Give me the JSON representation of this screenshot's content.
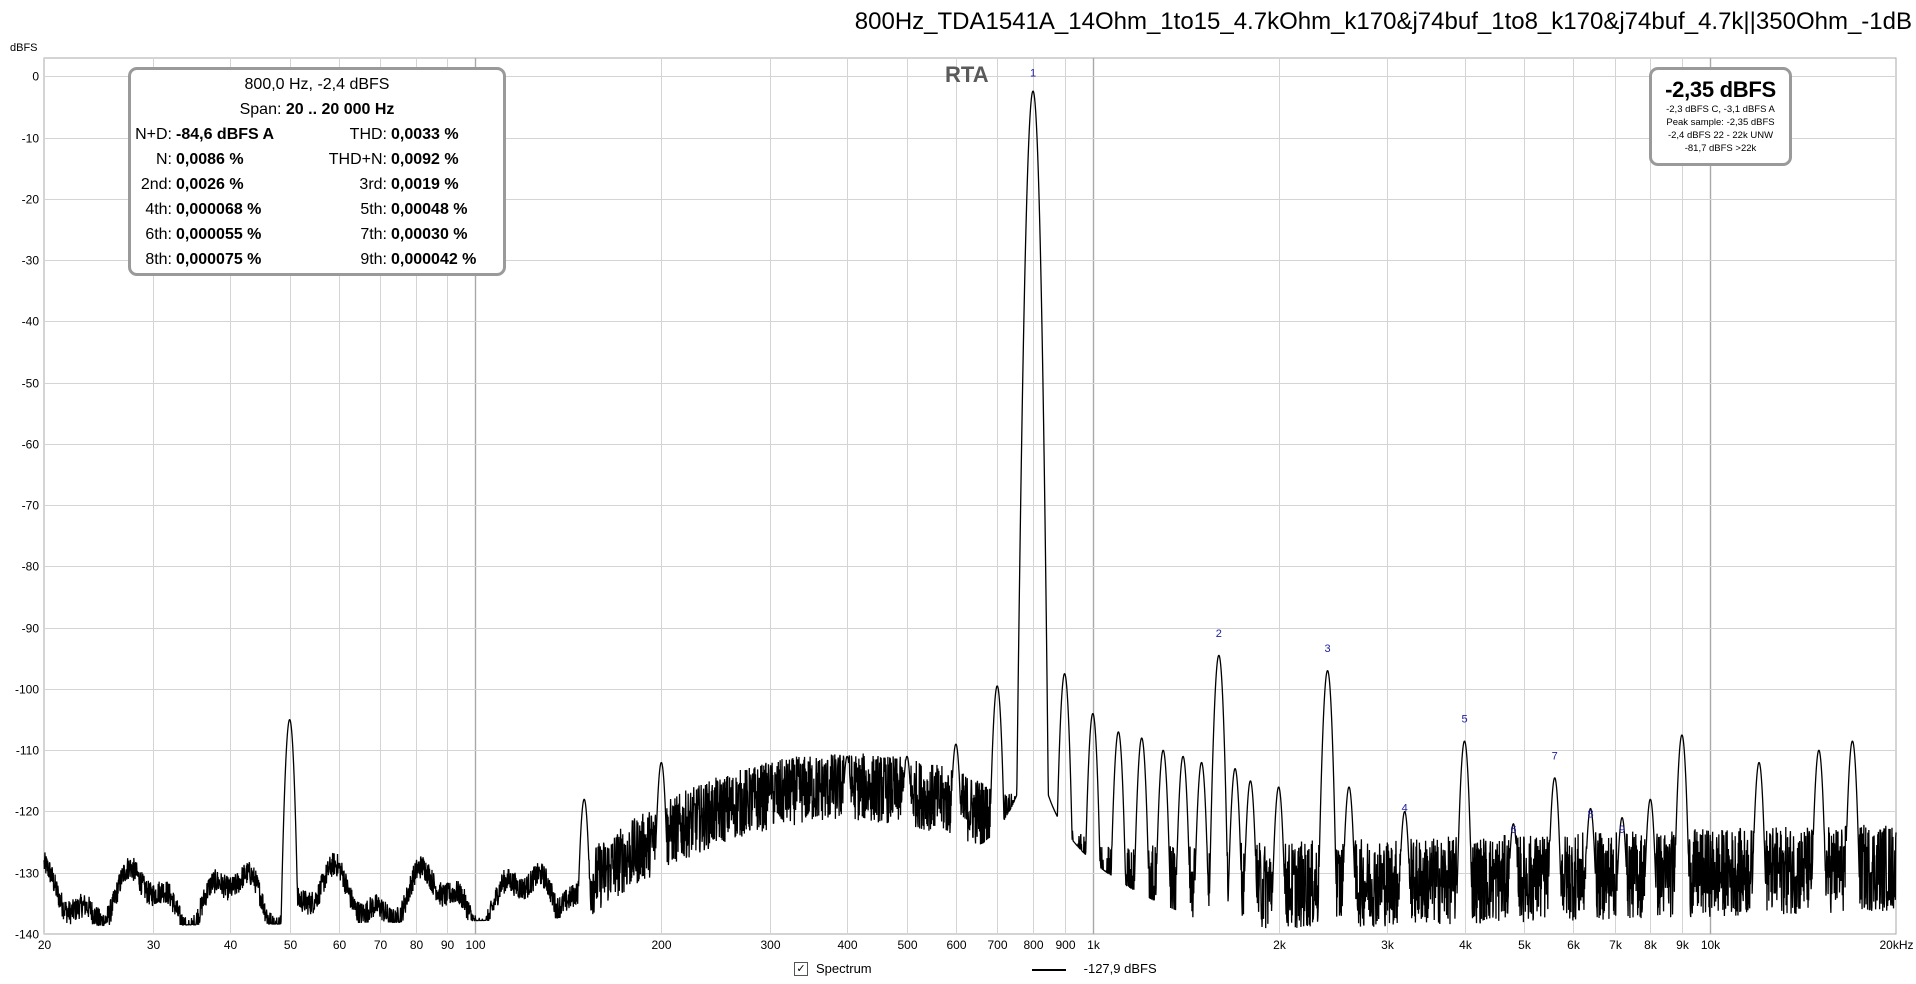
{
  "title": "800Hz_TDA1541A_14Ohm_1to15_4.7kOhm_k170&j74buf_1to8_k170&j74buf_4.7k||350Ohm_-1dB",
  "panel_label": "RTA",
  "y_unit": "dBFS",
  "stats": {
    "header": "800,0 Hz, -2,4 dBFS",
    "span_label": "Span:",
    "span_value": "20 .. 20 000 Hz",
    "rows": [
      {
        "l1": "N+D:",
        "v1": "-84,6 dBFS A",
        "l2": "THD:",
        "v2": "0,0033 %"
      },
      {
        "l1": "N:",
        "v1": "0,0086 %",
        "l2": "THD+N:",
        "v2": "0,0092 %"
      },
      {
        "l1": "2nd:",
        "v1": "0,0026 %",
        "l2": "3rd:",
        "v2": "0,0019 %"
      },
      {
        "l1": "4th:",
        "v1": "0,000068 %",
        "l2": "5th:",
        "v2": "0,00048 %"
      },
      {
        "l1": "6th:",
        "v1": "0,000055 %",
        "l2": "7th:",
        "v2": "0,00030 %"
      },
      {
        "l1": "8th:",
        "v1": "0,000075 %",
        "l2": "9th:",
        "v2": "0,000042 %"
      }
    ]
  },
  "level": {
    "main": "-2,35 dBFS",
    "line1": "-2,3 dBFS C, -3,1 dBFS A",
    "line2": "Peak sample: -2,35 dBFS",
    "line3": "-2,4 dBFS 22 - 22k UNW",
    "line4": "-81,7 dBFS >22k"
  },
  "legend": {
    "checkbox": "✓",
    "label": "Spectrum",
    "value": "-127,9 dBFS"
  },
  "colors": {
    "trace": "#000000",
    "major_grid": "#a8a8a8",
    "minor_grid": "#d4d4d4",
    "harmonic_label": "#1c1c9c",
    "box_border": "#9a9a9a"
  },
  "chart_data": {
    "type": "line",
    "x_scale": "log",
    "xlim": [
      20,
      20000
    ],
    "ylim": [
      -140,
      3
    ],
    "y_ticks": [
      0,
      -10,
      -20,
      -30,
      -40,
      -50,
      -60,
      -70,
      -80,
      -90,
      -100,
      -110,
      -120,
      -130,
      -140
    ],
    "y_tick_labels": [
      "0",
      "-10",
      "-20",
      "-30",
      "-40",
      "-50",
      "-60",
      "-70",
      "-80",
      "-90",
      "-100",
      "-110",
      "-120",
      "-130",
      "-140"
    ],
    "x_ticks": [
      20,
      30,
      40,
      50,
      60,
      70,
      80,
      90,
      100,
      200,
      300,
      400,
      500,
      600,
      700,
      800,
      900,
      1000,
      2000,
      3000,
      4000,
      5000,
      6000,
      7000,
      8000,
      9000,
      10000,
      20000
    ],
    "x_tick_labels": [
      "20",
      "30",
      "40",
      "50",
      "60",
      "70",
      "80",
      "90",
      "100",
      "200",
      "300",
      "400",
      "500",
      "600",
      "700",
      "800",
      "900",
      "1k",
      "2k",
      "3k",
      "4k",
      "5k",
      "6k",
      "7k",
      "8k",
      "9k",
      "10k",
      "20kHz"
    ],
    "grid": true,
    "series": [
      {
        "name": "Spectrum",
        "color": "#000000"
      }
    ],
    "peaks": [
      {
        "f": 50,
        "db": -105
      },
      {
        "f": 150,
        "db": -118
      },
      {
        "f": 200,
        "db": -112
      },
      {
        "f": 300,
        "db": -117
      },
      {
        "f": 400,
        "db": -111
      },
      {
        "f": 500,
        "db": -111
      },
      {
        "f": 600,
        "db": -109
      },
      {
        "f": 700,
        "db": -99.5
      },
      {
        "f": 800,
        "db": -2.4
      },
      {
        "f": 900,
        "db": -97.5
      },
      {
        "f": 1000,
        "db": -104
      },
      {
        "f": 1100,
        "db": -107
      },
      {
        "f": 1200,
        "db": -108
      },
      {
        "f": 1300,
        "db": -110
      },
      {
        "f": 1400,
        "db": -111
      },
      {
        "f": 1500,
        "db": -112
      },
      {
        "f": 1600,
        "db": -94.5
      },
      {
        "f": 1700,
        "db": -113
      },
      {
        "f": 1800,
        "db": -115
      },
      {
        "f": 2000,
        "db": -116
      },
      {
        "f": 2400,
        "db": -97
      },
      {
        "f": 2600,
        "db": -116
      },
      {
        "f": 3200,
        "db": -120
      },
      {
        "f": 4000,
        "db": -108.5
      },
      {
        "f": 4800,
        "db": -122
      },
      {
        "f": 5600,
        "db": -114.5
      },
      {
        "f": 6400,
        "db": -119.5
      },
      {
        "f": 7200,
        "db": -121
      },
      {
        "f": 8000,
        "db": -118
      },
      {
        "f": 9000,
        "db": -107.5
      },
      {
        "f": 12000,
        "db": -112
      },
      {
        "f": 15000,
        "db": -110
      },
      {
        "f": 17000,
        "db": -108.5
      }
    ],
    "bump": {
      "center_hz": 400,
      "level_db": -118
    },
    "harmonic_labels": [
      {
        "n": "1",
        "f": 800,
        "db": 0
      },
      {
        "n": "2",
        "f": 1600,
        "db": -91.5
      },
      {
        "n": "3",
        "f": 2400,
        "db": -94
      },
      {
        "n": "4",
        "f": 3200,
        "db": -120
      },
      {
        "n": "5",
        "f": 4000,
        "db": -105.5
      },
      {
        "n": "6",
        "f": 4800,
        "db": -123.5
      },
      {
        "n": "7",
        "f": 5600,
        "db": -111.5
      },
      {
        "n": "8",
        "f": 6400,
        "db": -121
      },
      {
        "n": "9",
        "f": 7200,
        "db": -123.5
      }
    ]
  }
}
